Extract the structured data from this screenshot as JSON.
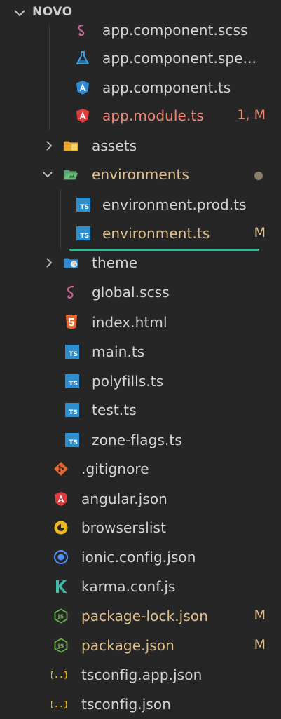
{
  "explorer": {
    "section_title": "NOVO"
  },
  "colors": {
    "background": "#262626",
    "modified": "#e2c08d",
    "error": "#f48771",
    "drop_indicator": "#1bc29a",
    "typescript": "#2c8fd0",
    "angular": "#dd3d3d",
    "sass": "#cd6799"
  },
  "tree": {
    "items": [
      {
        "label": "app.component.scss",
        "icon": "sass-icon",
        "status": "",
        "type": "file"
      },
      {
        "label": "app.component.spe...",
        "icon": "flask-icon",
        "status": "",
        "type": "file"
      },
      {
        "label": "app.component.ts",
        "icon": "angular-component-icon",
        "status": "",
        "type": "file"
      },
      {
        "label": "app.module.ts",
        "icon": "angular-icon",
        "status": "1, M",
        "type": "file"
      },
      {
        "label": "assets",
        "icon": "folder-icon",
        "status": "",
        "type": "folder"
      },
      {
        "label": "environments",
        "icon": "folder-open-icon",
        "status": "",
        "type": "folder"
      },
      {
        "label": "environment.prod.ts",
        "icon": "typescript-icon",
        "status": "",
        "type": "file"
      },
      {
        "label": "environment.ts",
        "icon": "typescript-icon",
        "status": "M",
        "type": "file"
      },
      {
        "label": "theme",
        "icon": "palette-folder-icon",
        "status": "",
        "type": "folder"
      },
      {
        "label": "global.scss",
        "icon": "sass-icon",
        "status": "",
        "type": "file"
      },
      {
        "label": "index.html",
        "icon": "html5-icon",
        "status": "",
        "type": "file"
      },
      {
        "label": "main.ts",
        "icon": "typescript-icon",
        "status": "",
        "type": "file"
      },
      {
        "label": "polyfills.ts",
        "icon": "typescript-icon",
        "status": "",
        "type": "file"
      },
      {
        "label": "test.ts",
        "icon": "typescript-icon",
        "status": "",
        "type": "file"
      },
      {
        "label": "zone-flags.ts",
        "icon": "typescript-icon",
        "status": "",
        "type": "file"
      },
      {
        "label": ".gitignore",
        "icon": "git-icon",
        "status": "",
        "type": "file"
      },
      {
        "label": "angular.json",
        "icon": "angular-icon",
        "status": "",
        "type": "file"
      },
      {
        "label": "browserslist",
        "icon": "browserslist-icon",
        "status": "",
        "type": "file"
      },
      {
        "label": "ionic.config.json",
        "icon": "ionic-icon",
        "status": "",
        "type": "file"
      },
      {
        "label": "karma.conf.js",
        "icon": "karma-icon",
        "status": "",
        "type": "file"
      },
      {
        "label": "package-lock.json",
        "icon": "nodejs-icon",
        "status": "M",
        "type": "file"
      },
      {
        "label": "package.json",
        "icon": "nodejs-icon",
        "status": "M",
        "type": "file"
      },
      {
        "label": "tsconfig.app.json",
        "icon": "json-braces-icon",
        "status": "",
        "type": "file"
      },
      {
        "label": "tsconfig.json",
        "icon": "json-braces-icon",
        "status": "",
        "type": "file"
      }
    ]
  }
}
